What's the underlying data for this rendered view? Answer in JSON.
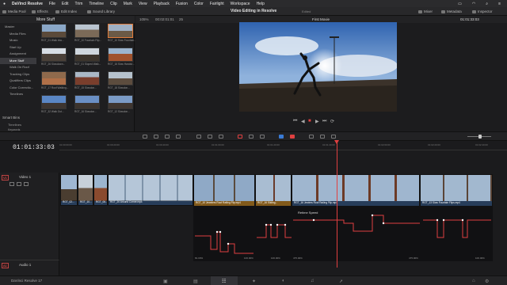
{
  "menubar": {
    "app": "DaVinci Resolve",
    "items": [
      "File",
      "Edit",
      "Trim",
      "Timeline",
      "Clip",
      "Mark",
      "View",
      "Playback",
      "Fusion",
      "Color",
      "Fairlight",
      "Workspace",
      "Help"
    ]
  },
  "toolbar": {
    "media_pool": "Media Pool",
    "effects": "Effects",
    "edit_index": "Edit Index",
    "sound_library": "Sound Library",
    "project_title": "Video Editing in Resolve",
    "project_status": "Edited",
    "mixer": "Mixer",
    "metadata": "Metadata",
    "inspector": "Inspector"
  },
  "media_pool": {
    "current_bin": "More Stuff",
    "bins": [
      "Master",
      "Media Files",
      "Music",
      "Start Up",
      "Assignment",
      "More Stuff",
      "Walk On Roof",
      "Tracking Clips",
      "Qualifiers Clips",
      "Color Correctio...",
      "Timelines"
    ],
    "smart_bins_label": "Smart Bins",
    "smart_bins": [
      "Timelines",
      "Keywords",
      "Slow motion"
    ],
    "clips": [
      "RGT_01 Walk Into...",
      "RGT_10 Fountain Flip...",
      "RGT_10 Slow Fountain...",
      "RGT_26 Slowdown...",
      "RGT_01 Sloped Walk...",
      "RGT_16 Slow Handst...",
      "RGT_17 Roof Walking...",
      "RGT_15 Slowdon...",
      "RGT_18 Slowdon...",
      "RGT_32 Walk Out...",
      "RGT_16 Slowdon...",
      "RGT_12 Slowdon..."
    ]
  },
  "viewer": {
    "zoom": "105%",
    "timecode_left": "00:02:01:01",
    "speed": "25",
    "title": "First Movie",
    "timecode_right": "01:01:33:03"
  },
  "timeline": {
    "timecode": "01:01:33:03",
    "ruler_ticks": [
      "01:00:00:00",
      "01:00:20:00",
      "01:00:40:00",
      "01:01:00:00",
      "01:01:20:00",
      "01:01:40:00",
      "01:02:00:00",
      "01:02:20:00",
      "01:02:40:00"
    ],
    "video_track": "Video 1",
    "video_tag": "V1",
    "audio_track": "Audio 1",
    "audio_tag": "A1",
    "clip_labels": [
      "RGT_02...",
      "RGT_10...",
      "RGT_06...",
      "RGT_20 Around Corner.mp4",
      "RGT_10 Jewelers Roof Railing Flip.mp4",
      "RGT_16 Sliding...",
      "RGT_16 Jewlers Roof Railing Flip.mp4",
      "RGT_13 Slow Fountain Flips.mp4"
    ],
    "retime_label": "Retime Speed",
    "curve_pct_labels": [
      "81.00%",
      "100.00%",
      "100.00%",
      "475.00%",
      "475.00%",
      "100.00%"
    ]
  },
  "footer": {
    "brand": "DaVinci Resolve 17"
  }
}
